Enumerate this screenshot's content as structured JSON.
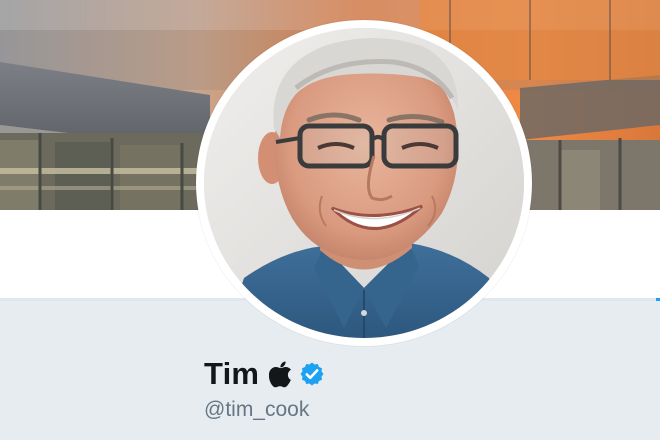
{
  "profile": {
    "display_name": "Tim",
    "name_icon": "apple-logo-icon",
    "verified_badge": "verified-badge-icon",
    "handle": "@tim_cook"
  },
  "banner": {
    "description_icon": "banner-image"
  },
  "colors": {
    "name_text": "#14171a",
    "handle_text": "#657786",
    "verified_blue": "#1da1f2",
    "panel_background": "#e6ecf0"
  }
}
